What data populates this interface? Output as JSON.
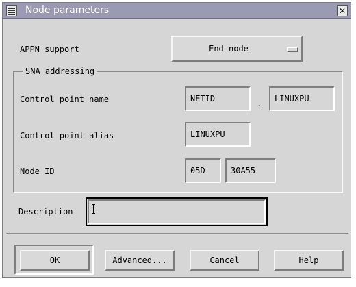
{
  "window": {
    "title": "Node parameters",
    "close_glyph": "✕"
  },
  "appn": {
    "label": "APPN support",
    "value": "End node"
  },
  "sna_group": {
    "legend": "SNA addressing"
  },
  "cp_name": {
    "label": "Control point name",
    "netid": "NETID",
    "separator": ".",
    "name": "LINUXPU"
  },
  "cp_alias": {
    "label": "Control point alias",
    "value": "LINUXPU"
  },
  "node_id": {
    "label": "Node ID",
    "block": "05D",
    "number": "30A55"
  },
  "description": {
    "label": "Description",
    "value": ""
  },
  "buttons": {
    "ok": "OK",
    "advanced": "Advanced...",
    "cancel": "Cancel",
    "help": "Help"
  },
  "colors": {
    "titlebar": "#9a9ab2",
    "dialog": "#d6d6d6"
  }
}
